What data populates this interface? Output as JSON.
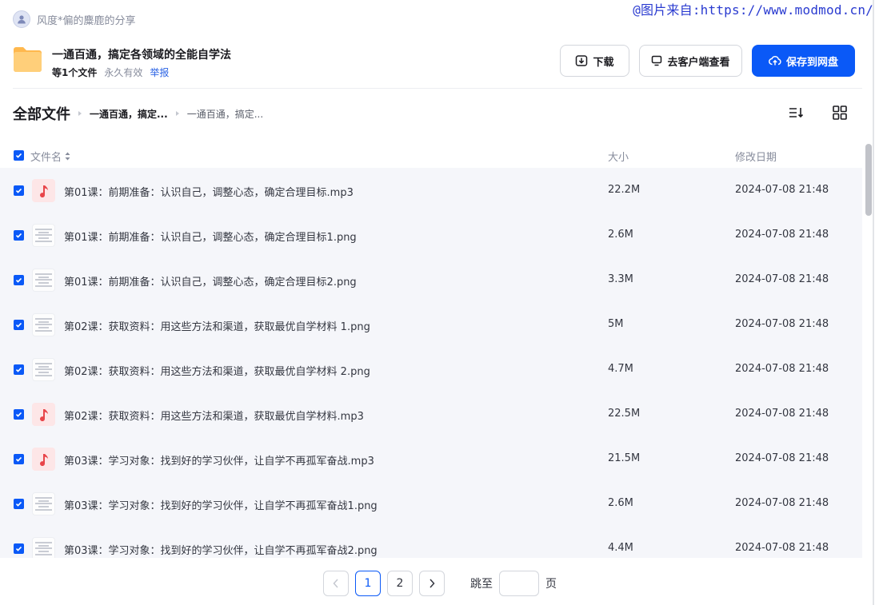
{
  "watermark": "@图片来自:https://www.modmod.cn/",
  "sharer": {
    "name": "风度*偏的麋鹿的分享"
  },
  "share": {
    "title": "一通百通，搞定各领域的全能自学法",
    "file_count": "等1个文件",
    "validity": "永久有效",
    "report": "举报"
  },
  "actions": {
    "download": "下载",
    "open_client": "去客户端查看",
    "save": "保存到网盘"
  },
  "colors": {
    "accent": "#0a59f7",
    "audio_icon": "#e8454a"
  },
  "breadcrumb": {
    "root": "全部文件",
    "items": [
      "一通百通，搞定...",
      "一通百通，搞定..."
    ]
  },
  "columns": {
    "name": "文件名",
    "size": "大小",
    "date": "修改日期"
  },
  "files": [
    {
      "name": "第01课：前期准备：认识自己，调整心态，确定合理目标.mp3",
      "size": "22.2M",
      "date": "2024-07-08 21:48",
      "icon": "audio-icon"
    },
    {
      "name": "第01课：前期准备：认识自己，调整心态，确定合理目标1.png",
      "size": "2.6M",
      "date": "2024-07-08 21:48",
      "icon": "image-thumbnail"
    },
    {
      "name": "第01课：前期准备：认识自己，调整心态，确定合理目标2.png",
      "size": "3.3M",
      "date": "2024-07-08 21:48",
      "icon": "image-thumbnail"
    },
    {
      "name": "第02课：获取资料：用这些方法和渠道，获取最优自学材料 1.png",
      "size": "5M",
      "date": "2024-07-08 21:48",
      "icon": "image-thumbnail"
    },
    {
      "name": "第02课：获取资料：用这些方法和渠道，获取最优自学材料 2.png",
      "size": "4.7M",
      "date": "2024-07-08 21:48",
      "icon": "image-thumbnail"
    },
    {
      "name": "第02课：获取资料：用这些方法和渠道，获取最优自学材料.mp3",
      "size": "22.5M",
      "date": "2024-07-08 21:48",
      "icon": "audio-icon"
    },
    {
      "name": "第03课：学习对象：找到好的学习伙伴，让自学不再孤军奋战.mp3",
      "size": "21.5M",
      "date": "2024-07-08 21:48",
      "icon": "audio-icon"
    },
    {
      "name": "第03课：学习对象：找到好的学习伙伴，让自学不再孤军奋战1.png",
      "size": "2.6M",
      "date": "2024-07-08 21:48",
      "icon": "image-thumbnail"
    },
    {
      "name": "第03课：学习对象：找到好的学习伙伴，让自学不再孤军奋战2.png",
      "size": "4.4M",
      "date": "2024-07-08 21:48",
      "icon": "image-thumbnail"
    }
  ],
  "pagination": {
    "pages": [
      "1",
      "2"
    ],
    "current": "1",
    "jump_label": "跳至",
    "page_unit": "页",
    "jump_value": ""
  }
}
